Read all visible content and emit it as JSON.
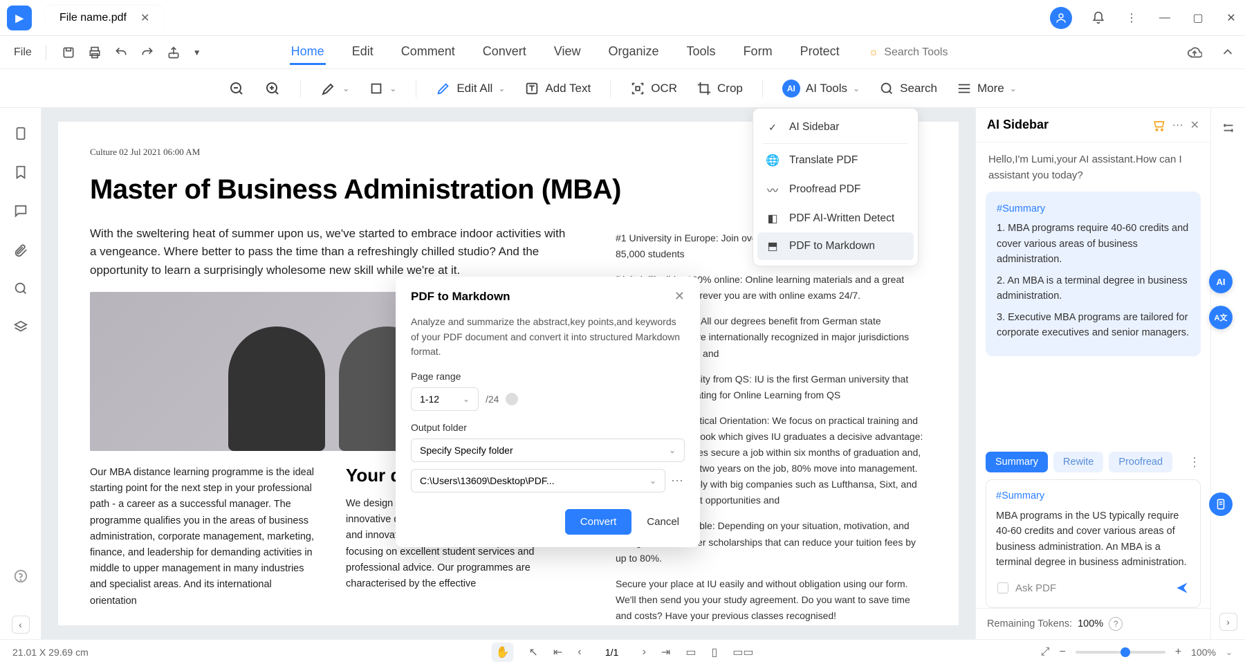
{
  "titlebar": {
    "file_name": "File name.pdf"
  },
  "menubar": {
    "file": "File",
    "tabs": [
      "Home",
      "Edit",
      "Comment",
      "Convert",
      "View",
      "Organize",
      "Tools",
      "Form",
      "Protect"
    ],
    "active_tab": "Home",
    "search_placeholder": "Search Tools"
  },
  "toolbar": {
    "edit_all": "Edit All",
    "add_text": "Add Text",
    "ocr": "OCR",
    "crop": "Crop",
    "ai_tools": "AI Tools",
    "search": "Search",
    "more": "More"
  },
  "ai_dropdown": {
    "items": [
      "AI Sidebar",
      "Translate PDF",
      "Proofread PDF",
      "PDF AI-Written Detect",
      "PDF to Markdown"
    ],
    "selected": "PDF to Markdown"
  },
  "modal": {
    "title": "PDF to Markdown",
    "desc": "Analyze and summarize the abstract,key points,and keywords of your PDF document and convert it into structured Markdown format.",
    "page_range_label": "Page range",
    "page_range_value": "1-12",
    "total_pages": "/24",
    "output_label": "Output folder",
    "output_mode": "Specify Specify folder",
    "output_path": "C:\\Users\\13609\\Desktop\\PDF...",
    "convert": "Convert",
    "cancel": "Cancel"
  },
  "ai_sidebar": {
    "title": "AI Sidebar",
    "greeting": "Hello,I'm Lumi,your AI assistant.How can I assistant you today?",
    "summary_tag": "#Summary",
    "summary_points": [
      "1. MBA programs require 40-60 credits and cover various areas of business administration.",
      "2. An MBA is a terminal degree in business administration.",
      "3. Executive MBA programs are tailored for corporate executives and senior managers."
    ],
    "chips": [
      "Summary",
      "Rewite",
      "Proofread"
    ],
    "result_tag": "#Summary",
    "result_text": "MBA programs in the US typically require 40-60 credits and cover various areas of business administration. An MBA is a terminal degree in business administration.",
    "ask_placeholder": "Ask PDF",
    "tokens_label": "Remaining Tokens:",
    "tokens_value": "100%"
  },
  "document": {
    "meta": "Culture 02 Jul 2021 06:00 AM",
    "headline": "Master of Business Administration (MBA)",
    "intro": "With the sweltering heat of summer upon us, we've started to embrace indoor activities with a vengeance. Where better to pass the time than a refreshingly chilled studio? And the opportunity to learn a surprisingly wholesome new skill while we're at it.",
    "h2": "Your de",
    "left_body": "Our MBA distance learning programme is the ideal starting point for the next step in your professional path - a career as a successful manager. The programme qualifies you in the areas of business administration, corporate management, marketing, finance, and leadership for demanding activities in middle to upper management in many industries and specialist areas. And its international orientation",
    "mid_body": "We design our programmes to be as flexible and innovative quality. We deliver specialist expertise and innovative learning materials as well as focusing on excellent student services and professional advice. Our programmes are characterised by the effective",
    "side_paras": [
      "#1 University in Europe: Join over 85,000 students and more than 85,000 students",
      "Digital, Flexible, 100% online: Online learning materials and a great online platform wherever you are with online exams 24/7.",
      "Accredited Degree: All our degrees benefit from German state accreditation and are internationally recognized in major jurisdictions such as the EU, US and",
      "5-star rated University from QS: IU is the first German university that achieved a 5-star rating for Online Learning from QS",
      "Career Focus, Practical Orientation: We focus on practical training and an international outlook which gives IU graduates a decisive advantage: 94% of our graduates secure a job within six months of graduation and, after an average of two years on the job, 80% move into management. Plus, we work closely with big companies such as Lufthansa, Sixt, and EY to give you great opportunities and",
      "Scholarships Available: Depending on your situation, motivation, and background, we offer scholarships that can reduce your tuition fees by up to 80%.",
      "Secure your place at IU easily and without obligation using our form. We'll then send you your study agreement. Do you want to save time and costs? Have your previous classes recognised!"
    ]
  },
  "statusbar": {
    "dims": "21.01 X 29.69 cm",
    "page": "1/1",
    "zoom": "100%"
  }
}
